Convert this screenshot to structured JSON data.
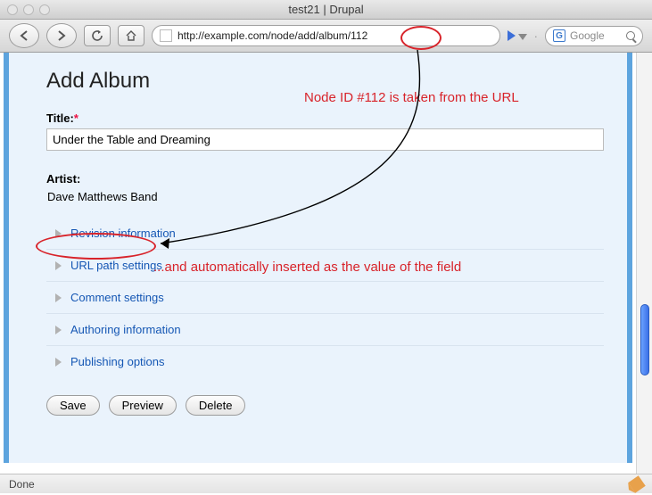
{
  "window": {
    "title": "test21 | Drupal"
  },
  "toolbar": {
    "url": "http://example.com/node/add/album/112",
    "search_placeholder": "Google"
  },
  "page": {
    "heading": "Add Album",
    "title_label": "Title:",
    "title_value": "Under the Table and Dreaming",
    "artist_label": "Artist:",
    "artist_value": "Dave Matthews Band",
    "fieldsets": [
      "Revision information",
      "URL path settings",
      "Comment settings",
      "Authoring information",
      "Publishing options"
    ],
    "buttons": {
      "save": "Save",
      "preview": "Preview",
      "delete": "Delete"
    }
  },
  "annotations": {
    "top": "Node ID #112 is taken from the URL",
    "mid": "...and automatically inserted as the value of the field"
  },
  "status": {
    "text": "Done"
  }
}
